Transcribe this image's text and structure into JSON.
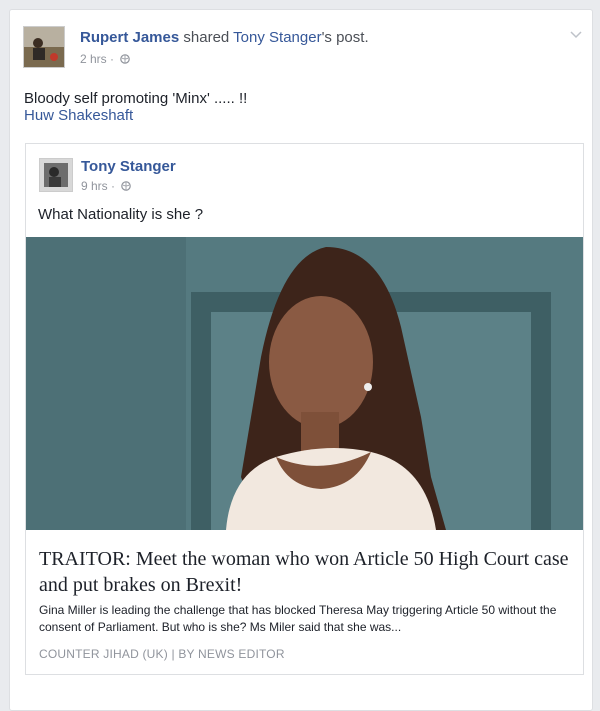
{
  "post": {
    "author": "Rupert James",
    "action": "shared",
    "shared_from": "Tony Stanger",
    "shared_suffix": "'s post.",
    "time": "2 hrs",
    "privacy_icon": "globe-icon",
    "text": "Bloody self promoting 'Minx' ..... !!",
    "tag": "Huw Shakeshaft",
    "menu_icon": "chevron-down-icon"
  },
  "shared_post": {
    "author": "Tony Stanger",
    "time": "9 hrs",
    "privacy_icon": "globe-icon",
    "text": "What Nationality is she ?",
    "link": {
      "headline": "TRAITOR: Meet the woman who won Article 50 High Court case and put brakes on Brexit!",
      "description": "Gina Miller is leading the challenge that has blocked Theresa May triggering Article 50 without the consent of Parliament. But who is she? Ms Miler said that she was...",
      "source": "COUNTER JIHAD (UK) | BY NEWS EDITOR"
    }
  },
  "colors": {
    "link": "#365899",
    "meta": "#90949c",
    "background": "#e9ebee"
  }
}
